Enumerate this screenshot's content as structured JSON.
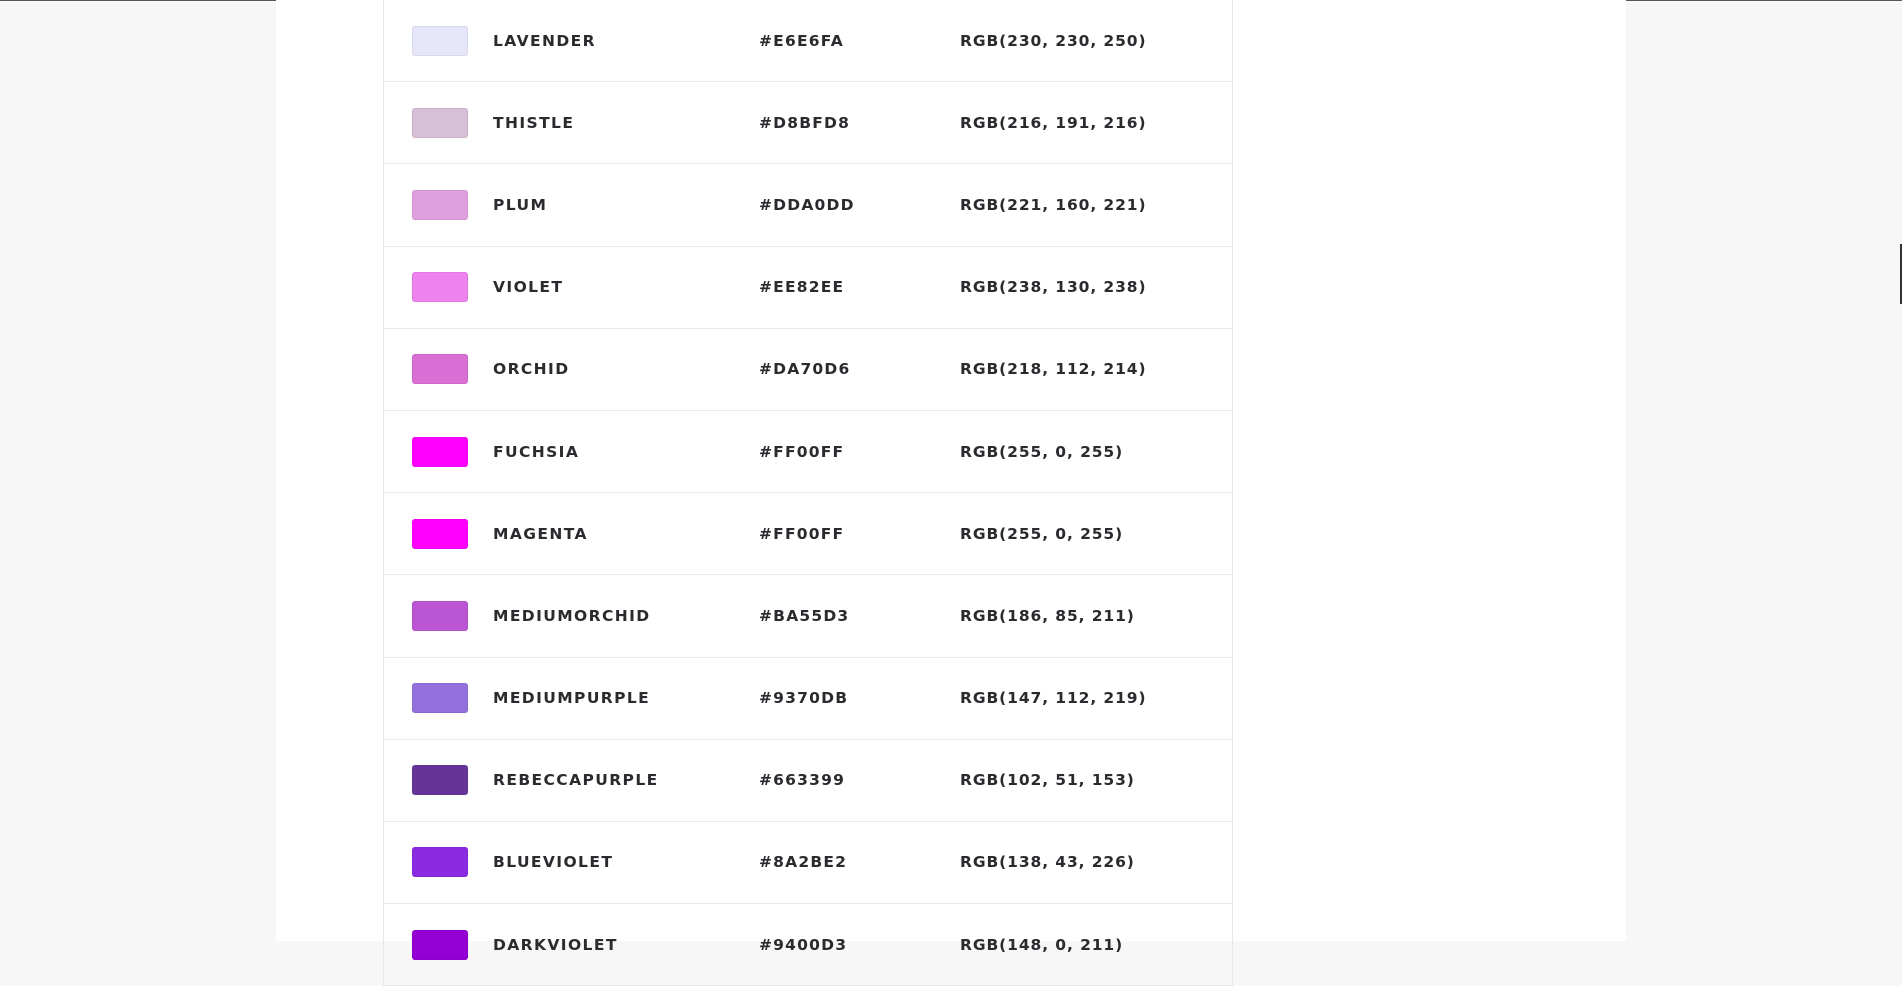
{
  "colors": [
    {
      "name": "LAVENDER",
      "hex": "#E6E6FA",
      "rgb": "RGB(230, 230, 250)",
      "swatch": "#E6E6FA"
    },
    {
      "name": "THISTLE",
      "hex": "#D8BFD8",
      "rgb": "RGB(216, 191, 216)",
      "swatch": "#D8BFD8"
    },
    {
      "name": "PLUM",
      "hex": "#DDA0DD",
      "rgb": "RGB(221, 160, 221)",
      "swatch": "#DDA0DD"
    },
    {
      "name": "VIOLET",
      "hex": "#EE82EE",
      "rgb": "RGB(238, 130, 238)",
      "swatch": "#EE82EE"
    },
    {
      "name": "ORCHID",
      "hex": "#DA70D6",
      "rgb": "RGB(218, 112, 214)",
      "swatch": "#DA70D6"
    },
    {
      "name": "FUCHSIA",
      "hex": "#FF00FF",
      "rgb": "RGB(255, 0, 255)",
      "swatch": "#FF00FF"
    },
    {
      "name": "MAGENTA",
      "hex": "#FF00FF",
      "rgb": "RGB(255, 0, 255)",
      "swatch": "#FF00FF"
    },
    {
      "name": "MEDIUMORCHID",
      "hex": "#BA55D3",
      "rgb": "RGB(186, 85, 211)",
      "swatch": "#BA55D3"
    },
    {
      "name": "MEDIUMPURPLE",
      "hex": "#9370DB",
      "rgb": "RGB(147, 112, 219)",
      "swatch": "#9370DB"
    },
    {
      "name": "REBECCAPURPLE",
      "hex": "#663399",
      "rgb": "RGB(102, 51, 153)",
      "swatch": "#663399"
    },
    {
      "name": "BLUEVIOLET",
      "hex": "#8A2BE2",
      "rgb": "RGB(138, 43, 226)",
      "swatch": "#8A2BE2"
    },
    {
      "name": "DARKVIOLET",
      "hex": "#9400D3",
      "rgb": "RGB(148, 0, 211)",
      "swatch": "#9400D3"
    }
  ]
}
